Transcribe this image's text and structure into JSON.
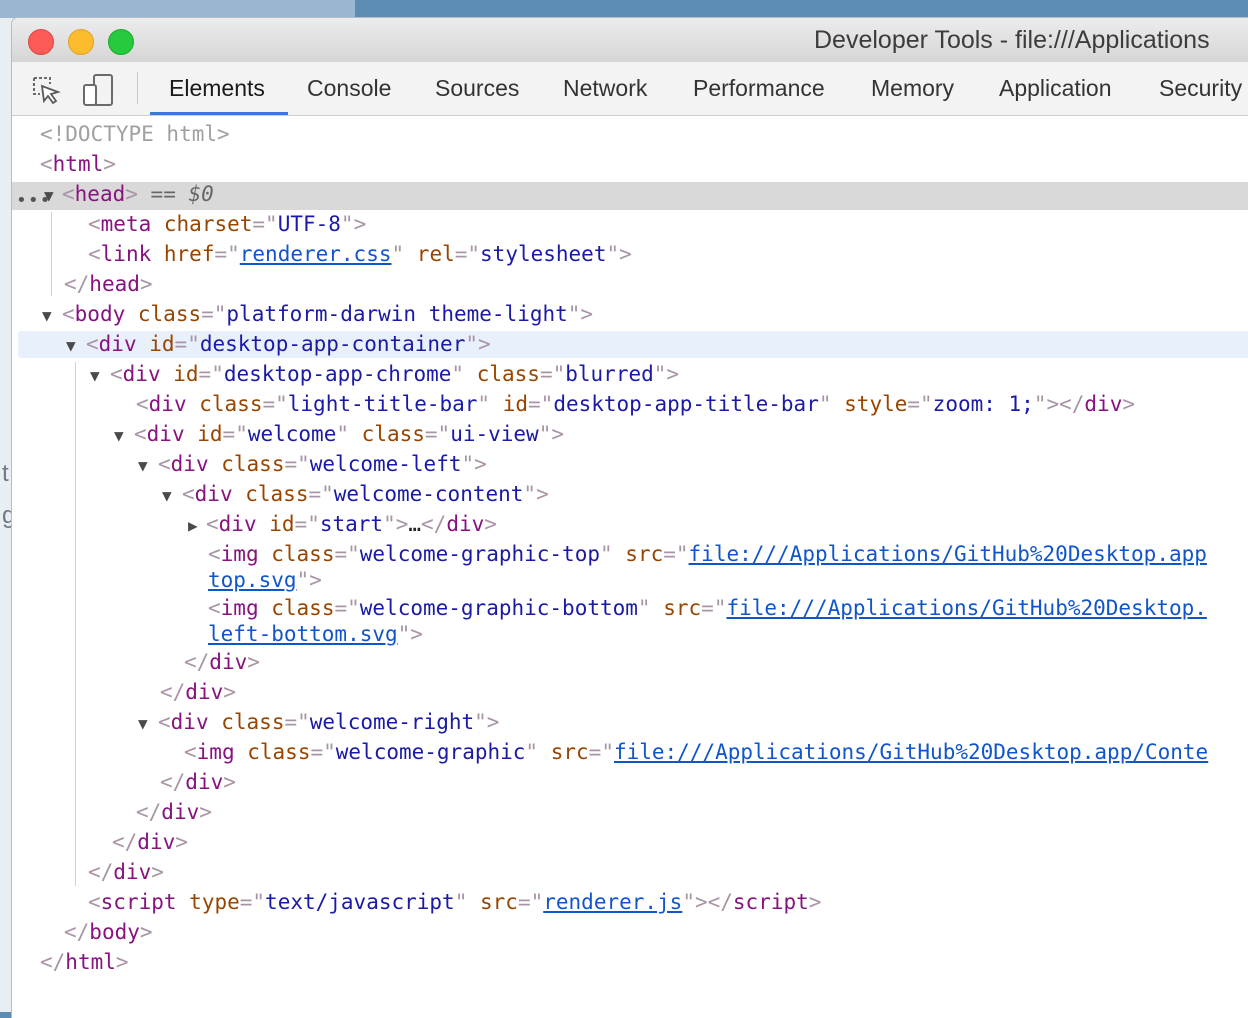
{
  "window": {
    "title": "Developer Tools - file:///Applications"
  },
  "toolbar": {
    "inspect_icon": "inspect-element-icon",
    "device_icon": "device-toolbar-icon",
    "tabs": [
      {
        "label": "Elements",
        "active": true
      },
      {
        "label": "Console"
      },
      {
        "label": "Sources"
      },
      {
        "label": "Network"
      },
      {
        "label": "Performance"
      },
      {
        "label": "Memory"
      },
      {
        "label": "Application"
      },
      {
        "label": "Security"
      }
    ]
  },
  "dom": {
    "doctype": "<!DOCTYPE html>",
    "html_open": "html",
    "head": {
      "tag": "head",
      "marker": "== $0"
    },
    "meta": {
      "tag": "meta",
      "attr": "charset",
      "value": "UTF-8"
    },
    "link": {
      "tag": "link",
      "attr1": "href",
      "val1": "renderer.css",
      "attr2": "rel",
      "val2": "stylesheet"
    },
    "head_close": "head",
    "body": {
      "tag": "body",
      "attr": "class",
      "value": "platform-darwin theme-light"
    },
    "container": {
      "tag": "div",
      "attr": "id",
      "value": "desktop-app-container"
    },
    "chrome": {
      "tag": "div",
      "attr1": "id",
      "val1": "desktop-app-chrome",
      "attr2": "class",
      "val2": "blurred"
    },
    "titlebar": {
      "tag": "div",
      "attr1": "class",
      "val1": "light-title-bar",
      "attr2": "id",
      "val2": "desktop-app-title-bar",
      "attr3": "style",
      "val3": "zoom: 1;"
    },
    "welcome": {
      "tag": "div",
      "attr1": "id",
      "val1": "welcome",
      "attr2": "class",
      "val2": "ui-view"
    },
    "welcome_left": {
      "tag": "div",
      "attr": "class",
      "value": "welcome-left"
    },
    "welcome_content": {
      "tag": "div",
      "attr": "class",
      "value": "welcome-content"
    },
    "start": {
      "tag": "div",
      "attr": "id",
      "value": "start",
      "ellipsis": "…"
    },
    "img_top": {
      "tag": "img",
      "attr1": "class",
      "val1": "welcome-graphic-top",
      "attr2": "src",
      "val2": "file:///Applications/GitHub%20Desktop.app",
      "cont": "top.svg"
    },
    "img_bottom": {
      "tag": "img",
      "attr1": "class",
      "val1": "welcome-graphic-bottom",
      "attr2": "src",
      "val2": "file:///Applications/GitHub%20Desktop.",
      "cont": "left-bottom.svg"
    },
    "div_close": "div",
    "welcome_right": {
      "tag": "div",
      "attr": "class",
      "value": "welcome-right"
    },
    "img_right": {
      "tag": "img",
      "attr1": "class",
      "val1": "welcome-graphic",
      "attr2": "src",
      "val2": "file:///Applications/GitHub%20Desktop.app/Conte"
    },
    "script": {
      "tag": "script",
      "attr1": "type",
      "val1": "text/javascript",
      "attr2": "src",
      "val2": "renderer.js"
    },
    "body_close": "body",
    "html_close": "html"
  }
}
